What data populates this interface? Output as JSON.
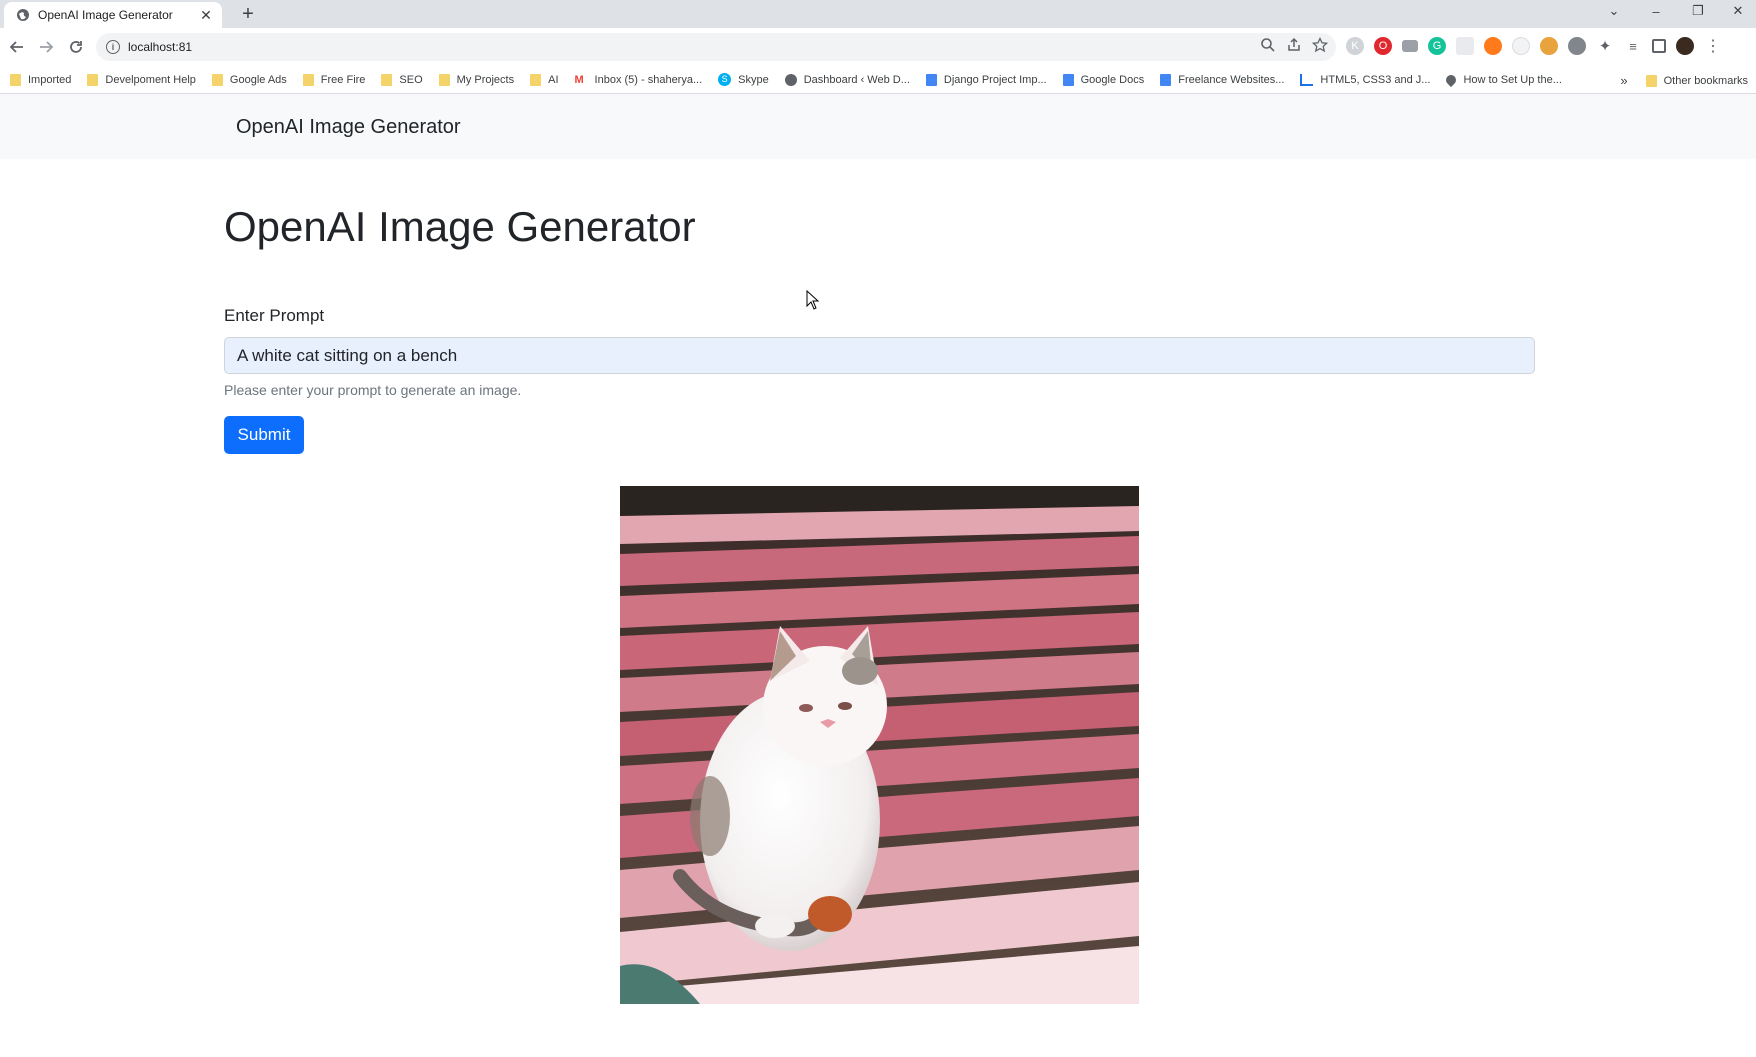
{
  "browser": {
    "tab_title": "OpenAI Image Generator",
    "url": "localhost:81",
    "bookmarks": [
      {
        "label": "Imported",
        "type": "folder"
      },
      {
        "label": "Develpoment Help",
        "type": "folder"
      },
      {
        "label": "Google Ads",
        "type": "folder"
      },
      {
        "label": "Free Fire",
        "type": "folder"
      },
      {
        "label": "SEO",
        "type": "folder"
      },
      {
        "label": "My Projects",
        "type": "folder"
      },
      {
        "label": "AI",
        "type": "folder"
      },
      {
        "label": "Inbox (5) - shaherya...",
        "type": "gmail"
      },
      {
        "label": "Skype",
        "type": "skype"
      },
      {
        "label": "Dashboard ‹ Web D...",
        "type": "globe"
      },
      {
        "label": "Django Project Imp...",
        "type": "docs"
      },
      {
        "label": "Google Docs",
        "type": "docs"
      },
      {
        "label": "Freelance Websites...",
        "type": "docs"
      },
      {
        "label": "HTML5, CSS3 and J...",
        "type": "chart"
      },
      {
        "label": "How to Set Up the...",
        "type": "drop"
      }
    ],
    "more_bookmarks": "»",
    "other_bookmarks": "Other bookmarks"
  },
  "navbar": {
    "brand": "OpenAI Image Generator"
  },
  "main": {
    "title": "OpenAI Image Generator",
    "prompt_label": "Enter Prompt",
    "prompt_value": "A white cat sitting on a bench",
    "helper_text": "Please enter your prompt to generate an image.",
    "submit_label": "Submit"
  }
}
